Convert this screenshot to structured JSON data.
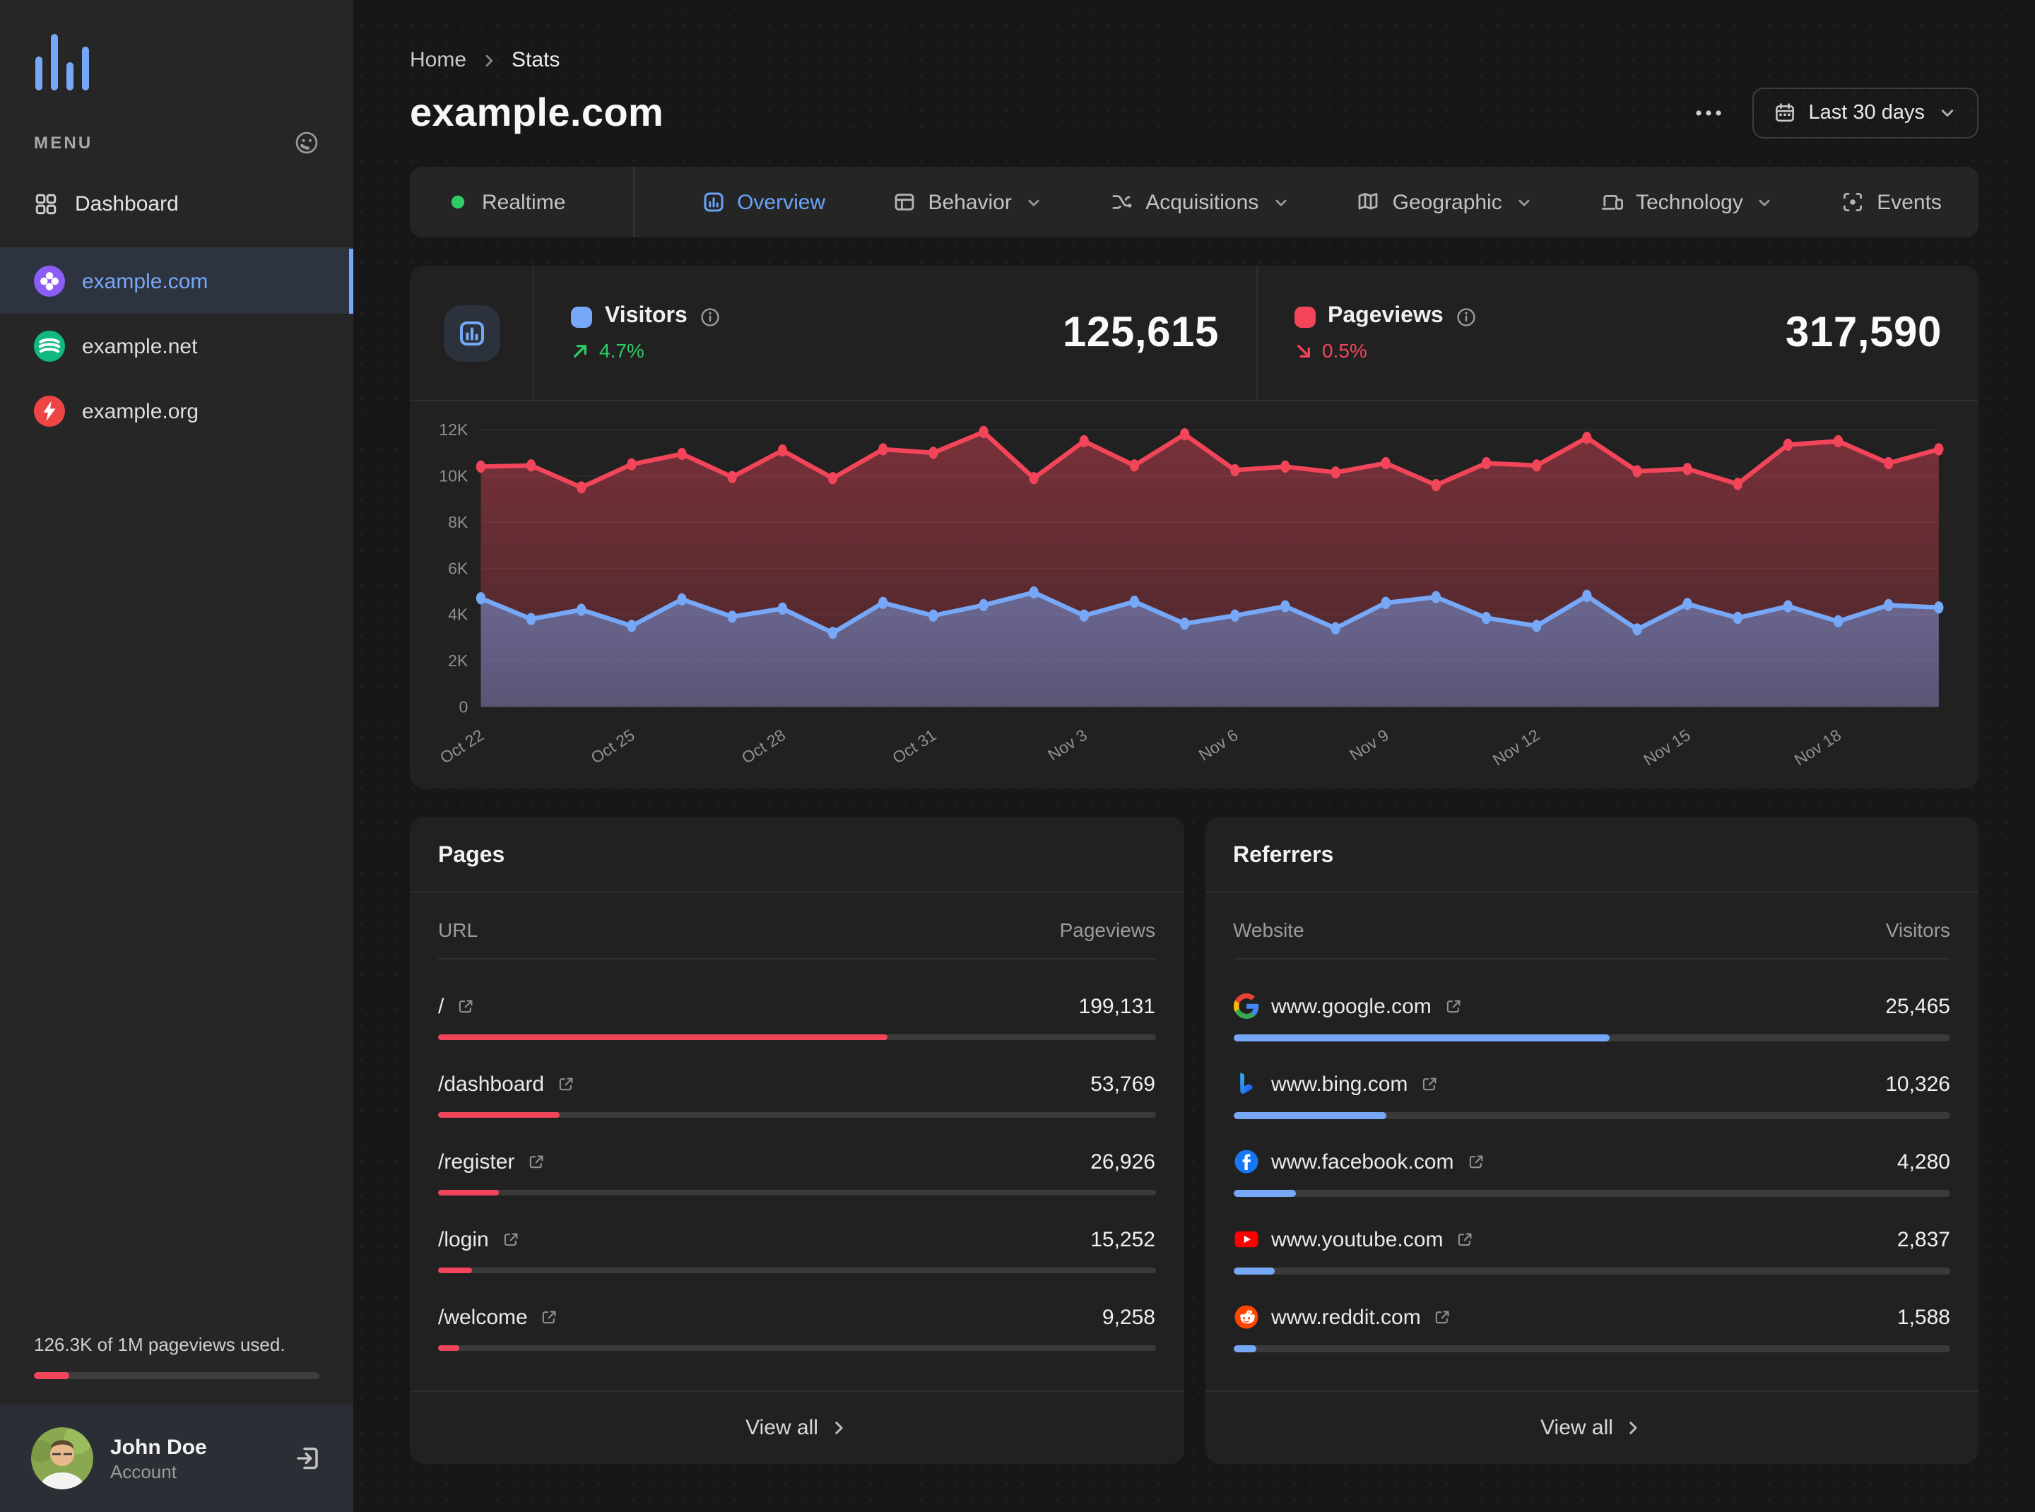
{
  "theme": {
    "accent_blue": "#77a8f8",
    "red": "#f2455a",
    "green": "#2ecc66",
    "purple": "#8b5cf6",
    "emerald": "#10b981",
    "site_red": "#ef4444",
    "page_bg": "#171717",
    "sidebar_bg": "#262626",
    "card_bg": "#212121"
  },
  "sidebar": {
    "menu_label": "MENU",
    "dashboard_label": "Dashboard",
    "sites": [
      {
        "name": "example.com",
        "icon": "clover",
        "color": "#8b5cf6",
        "active": true
      },
      {
        "name": "example.net",
        "icon": "waves",
        "color": "#10b981",
        "active": false
      },
      {
        "name": "example.org",
        "icon": "bolt",
        "color": "#ef4444",
        "active": false
      }
    ],
    "usage_text": "126.3K of 1M pageviews used.",
    "usage_pct": 12.6,
    "user": {
      "name": "John Doe",
      "role": "Account"
    }
  },
  "header": {
    "breadcrumb": [
      "Home",
      "Stats"
    ],
    "title": "example.com",
    "date_range": "Last 30 days"
  },
  "tabs": [
    {
      "label": "Realtime",
      "icon": "realtime-dot"
    },
    {
      "label": "Overview",
      "icon": "overview",
      "active": true
    },
    {
      "label": "Behavior",
      "icon": "behavior",
      "dropdown": true
    },
    {
      "label": "Acquisitions",
      "icon": "acquisitions",
      "dropdown": true
    },
    {
      "label": "Geographic",
      "icon": "geographic",
      "dropdown": true
    },
    {
      "label": "Technology",
      "icon": "technology",
      "dropdown": true
    },
    {
      "label": "Events",
      "icon": "events"
    }
  ],
  "stats": {
    "visitors": {
      "label": "Visitors",
      "value": "125,615",
      "change": "4.7%",
      "direction": "up",
      "color": "#77a8f8"
    },
    "pageviews": {
      "label": "Pageviews",
      "value": "317,590",
      "change": "0.5%",
      "direction": "down",
      "color": "#f2455a"
    }
  },
  "chart_data": {
    "type": "line",
    "x": [
      "Oct 22",
      "Oct 23",
      "Oct 24",
      "Oct 25",
      "Oct 26",
      "Oct 27",
      "Oct 28",
      "Oct 29",
      "Oct 30",
      "Oct 31",
      "Nov 1",
      "Nov 2",
      "Nov 3",
      "Nov 4",
      "Nov 5",
      "Nov 6",
      "Nov 7",
      "Nov 8",
      "Nov 9",
      "Nov 10",
      "Nov 11",
      "Nov 12",
      "Nov 13",
      "Nov 14",
      "Nov 15",
      "Nov 16",
      "Nov 17",
      "Nov 18",
      "Nov 19",
      "Nov 20"
    ],
    "xtick_indices": [
      0,
      3,
      6,
      9,
      12,
      15,
      18,
      21,
      24,
      27
    ],
    "series": [
      {
        "name": "Pageviews",
        "color": "#f2455a",
        "values": [
          10400,
          10450,
          9500,
          10500,
          10950,
          9950,
          11100,
          9900,
          11150,
          11000,
          11900,
          9900,
          11500,
          10450,
          11800,
          10250,
          10400,
          10150,
          10550,
          9600,
          10550,
          10450,
          11650,
          10200,
          10300,
          9650,
          11350,
          11500,
          10550,
          11150
        ]
      },
      {
        "name": "Visitors",
        "color": "#77a8f8",
        "values": [
          4700,
          3800,
          4200,
          3500,
          4650,
          3900,
          4250,
          3200,
          4500,
          3950,
          4400,
          4950,
          3950,
          4550,
          3600,
          3950,
          4350,
          3400,
          4500,
          4750,
          3850,
          3500,
          4800,
          3350,
          4450,
          3850,
          4350,
          3700,
          4400,
          4300
        ]
      }
    ],
    "ylim": [
      0,
      12000
    ],
    "yticks": [
      0,
      2000,
      4000,
      6000,
      8000,
      10000,
      12000
    ],
    "ytick_labels": [
      "0",
      "2K",
      "4K",
      "6K",
      "8K",
      "10K",
      "12K"
    ],
    "grid": true,
    "legend_position": "header"
  },
  "pages": {
    "title": "Pages",
    "col_label": "URL",
    "col_value": "Pageviews",
    "bar_color": "#f2455a",
    "rows": [
      {
        "label": "/",
        "value": "199,131",
        "pct": 62.7
      },
      {
        "label": "/dashboard",
        "value": "53,769",
        "pct": 16.9
      },
      {
        "label": "/register",
        "value": "26,926",
        "pct": 8.5
      },
      {
        "label": "/login",
        "value": "15,252",
        "pct": 4.8
      },
      {
        "label": "/welcome",
        "value": "9,258",
        "pct": 2.9
      }
    ],
    "view_all": "View all"
  },
  "referrers": {
    "title": "Referrers",
    "col_label": "Website",
    "col_value": "Visitors",
    "bar_color": "#77a8f8",
    "rows": [
      {
        "label": "www.google.com",
        "icon": "google",
        "value": "25,465",
        "pct": 52.5
      },
      {
        "label": "www.bing.com",
        "icon": "bing",
        "value": "10,326",
        "pct": 21.3
      },
      {
        "label": "www.facebook.com",
        "icon": "facebook",
        "value": "4,280",
        "pct": 8.8
      },
      {
        "label": "www.youtube.com",
        "icon": "youtube",
        "value": "2,837",
        "pct": 5.8
      },
      {
        "label": "www.reddit.com",
        "icon": "reddit",
        "value": "1,588",
        "pct": 3.3
      }
    ],
    "view_all": "View all"
  }
}
